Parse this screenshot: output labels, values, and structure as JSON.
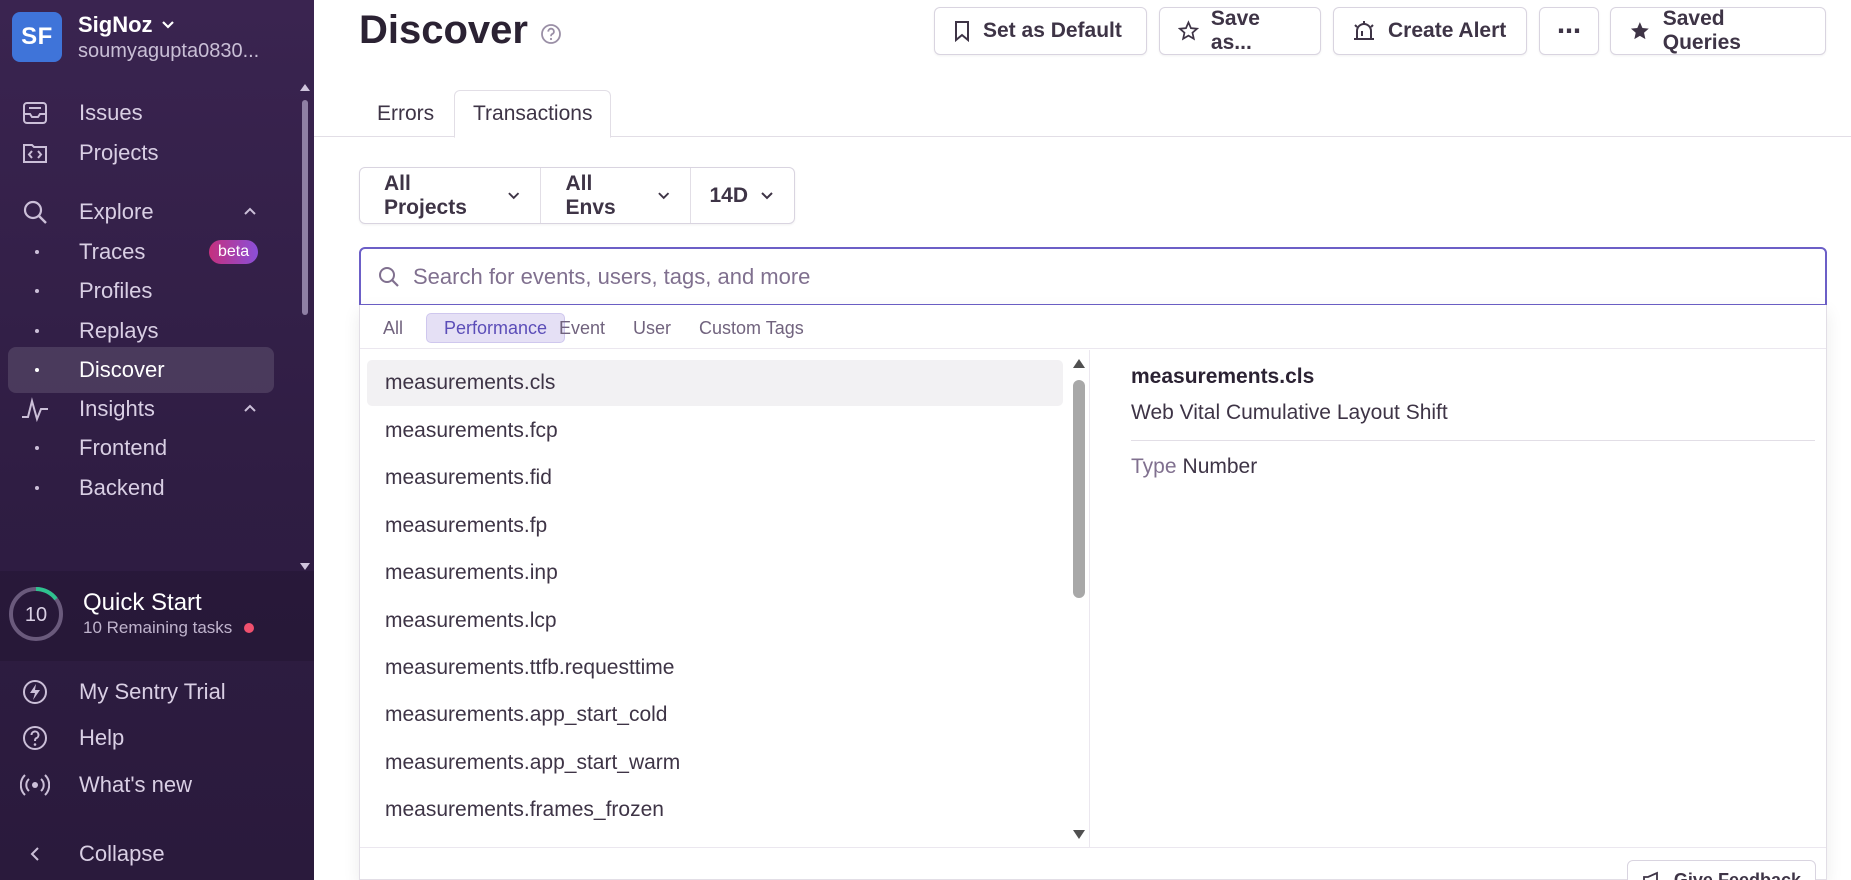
{
  "org": {
    "initials": "SF",
    "name": "SigNoz",
    "user": "soumyagupta0830..."
  },
  "sidebar": {
    "items": [
      {
        "label": "Issues",
        "icon": "inbox-icon"
      },
      {
        "label": "Projects",
        "icon": "code-folder-icon"
      },
      {
        "label": "Explore",
        "icon": "search-icon"
      },
      {
        "label": "Traces",
        "badge": "beta"
      },
      {
        "label": "Profiles"
      },
      {
        "label": "Replays"
      },
      {
        "label": "Discover",
        "active": true
      },
      {
        "label": "Insights",
        "icon": "chart-line-icon"
      },
      {
        "label": "Frontend"
      },
      {
        "label": "Backend"
      }
    ],
    "quick_start": {
      "count": "10",
      "title": "Quick Start",
      "subtitle": "10 Remaining tasks"
    },
    "bottom": [
      {
        "label": "My Sentry Trial",
        "icon": "lightning-icon"
      },
      {
        "label": "Help",
        "icon": "question-circle-icon"
      },
      {
        "label": "What's new",
        "icon": "broadcast-icon"
      },
      {
        "label": "Collapse",
        "icon": "chevron-left-icon"
      }
    ]
  },
  "header": {
    "title": "Discover",
    "buttons": {
      "set_default": "Set as Default",
      "save_as": "Save as...",
      "create_alert": "Create Alert",
      "more": "⋯",
      "saved_queries": "Saved Queries"
    }
  },
  "tabs": [
    "Errors",
    "Transactions"
  ],
  "filters": {
    "projects": "All Projects",
    "envs": "All Envs",
    "period": "14D"
  },
  "search": {
    "placeholder": "Search for events, users, tags, and more",
    "value": ""
  },
  "dropdown": {
    "categories": [
      "All",
      "Performance",
      "Event",
      "User",
      "Custom Tags"
    ],
    "active_category": "Performance",
    "items": [
      "measurements.cls",
      "measurements.fcp",
      "measurements.fid",
      "measurements.fp",
      "measurements.inp",
      "measurements.lcp",
      "measurements.ttfb.requesttime",
      "measurements.app_start_cold",
      "measurements.app_start_warm",
      "measurements.frames_frozen"
    ],
    "detail": {
      "title": "measurements.cls",
      "description": "Web Vital Cumulative Layout Shift",
      "type_label": "Type",
      "type_value": "Number"
    },
    "feedback": "Give Feedback"
  },
  "colors": {
    "sidebar": "#3a2450",
    "accent": "#6c5fc7",
    "org_avatar": "#3f74d9"
  }
}
